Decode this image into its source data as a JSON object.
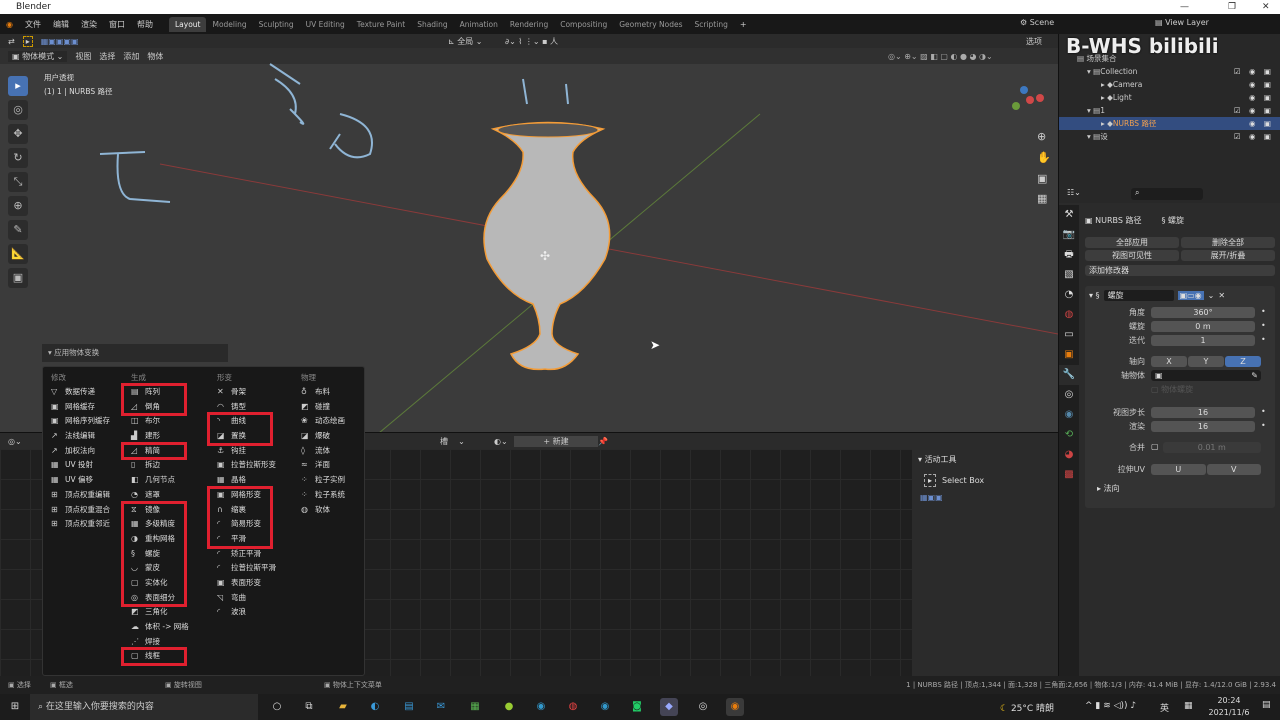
{
  "window": {
    "title": "Blender"
  },
  "menubar": {
    "items": [
      "文件",
      "编辑",
      "渲染",
      "窗口",
      "帮助"
    ],
    "workspaces": [
      "Layout",
      "Modeling",
      "Sculpting",
      "UV Editing",
      "Texture Paint",
      "Shading",
      "Animation",
      "Rendering",
      "Compositing",
      "Geometry Nodes",
      "Scripting"
    ],
    "scene": "Scene",
    "view_layer": "View Layer"
  },
  "viewport": {
    "mode": "物体模式",
    "menus": [
      "视图",
      "选择",
      "添加",
      "物体"
    ],
    "transform_orientation": "全局",
    "options": "选项",
    "view_name": "用户透视",
    "object_info": "(1) 1 | NURBS 路径"
  },
  "watermark": "B-WHS bilibili",
  "outliner": {
    "root": "场景集合",
    "rows": [
      {
        "label": "Collection",
        "level": 1
      },
      {
        "label": "Camera",
        "level": 2
      },
      {
        "label": "Light",
        "level": 2
      },
      {
        "label": "1",
        "level": 1
      },
      {
        "label": "NURBS 路径",
        "level": 2,
        "selected": true
      },
      {
        "label": "设",
        "level": 1
      }
    ]
  },
  "properties": {
    "object": "NURBS 路径",
    "modifier_tab": "螺旋",
    "apply_all": "全部应用",
    "delete_all": "删除全部",
    "viewport_vis": "视图可见性",
    "expand_collapse": "展开/折叠",
    "add_modifier": "添加修改器",
    "modifier": {
      "name": "螺旋",
      "fields": [
        {
          "label": "角度",
          "value": "360°"
        },
        {
          "label": "螺旋",
          "value": "0 m"
        },
        {
          "label": "迭代",
          "value": "1"
        }
      ],
      "axis_label": "轴向",
      "axes": [
        "X",
        "Y",
        "Z"
      ],
      "active_axis": "Z",
      "axis_object_label": "轴物体",
      "object_screw": "物体螺旋",
      "steps": [
        {
          "label": "视图步长",
          "value": "16"
        },
        {
          "label": "渲染",
          "value": "16"
        }
      ],
      "merge_label": "合并",
      "merge_value": "0.01 m",
      "stretch_uv_label": "拉伸UV",
      "uv": [
        "U",
        "V"
      ],
      "normals": "法向"
    }
  },
  "bottom": {
    "header_type": "槽",
    "new_button": "新建",
    "active_tool_title": "活动工具",
    "active_tool": "Select Box"
  },
  "popup": {
    "header": "应用物体变换",
    "columns": [
      {
        "title": "修改",
        "groups": [
          {
            "hl": false,
            "items": [
              [
                "▽",
                "数据传递"
              ],
              [
                "▣",
                "网格缓存"
              ],
              [
                "▣",
                "网格序列缓存"
              ],
              [
                "↗",
                "法线编辑"
              ],
              [
                "↗",
                "加权法向"
              ],
              [
                "▦",
                "UV 投射"
              ],
              [
                "▦",
                "UV 偏移"
              ],
              [
                "⊞",
                "顶点权重编辑"
              ],
              [
                "⊞",
                "顶点权重混合"
              ],
              [
                "⊞",
                "顶点权重邻近"
              ]
            ]
          }
        ]
      },
      {
        "title": "生成",
        "groups": [
          {
            "hl": true,
            "items": [
              [
                "▤",
                "阵列"
              ],
              [
                "◿",
                "倒角"
              ]
            ]
          },
          {
            "hl": false,
            "items": [
              [
                "◫",
                "布尔"
              ],
              [
                "▟",
                "建形"
              ]
            ]
          },
          {
            "hl": true,
            "items": [
              [
                "◿",
                "精简"
              ]
            ]
          },
          {
            "hl": false,
            "items": [
              [
                "▯",
                "拆边"
              ],
              [
                "◧",
                "几何节点"
              ],
              [
                "◔",
                "遮罩"
              ]
            ]
          },
          {
            "hl": true,
            "items": [
              [
                "⧖",
                "镜像"
              ],
              [
                "▦",
                "多级精度"
              ],
              [
                "◑",
                "重构网格"
              ],
              [
                "§",
                "螺旋"
              ],
              [
                "◡",
                "蒙皮"
              ],
              [
                "▢",
                "实体化"
              ],
              [
                "◎",
                "表面细分"
              ]
            ]
          },
          {
            "hl": false,
            "items": [
              [
                "◩",
                "三角化"
              ],
              [
                "☁",
                "体积 -> 网格"
              ],
              [
                "⋰",
                "焊接"
              ]
            ]
          },
          {
            "hl": true,
            "items": [
              [
                "▢",
                "线框"
              ]
            ]
          }
        ]
      },
      {
        "title": "形变",
        "groups": [
          {
            "hl": false,
            "items": [
              [
                "✕",
                "骨架"
              ],
              [
                "◠",
                "铸型"
              ]
            ]
          },
          {
            "hl": true,
            "items": [
              [
                "◝",
                "曲线"
              ],
              [
                "◪",
                "置换"
              ]
            ]
          },
          {
            "hl": false,
            "items": [
              [
                "⚓",
                "钩挂"
              ],
              [
                "▣",
                "拉普拉斯形变"
              ],
              [
                "▦",
                "晶格"
              ]
            ]
          },
          {
            "hl": true,
            "items": [
              [
                "▣",
                "网格形变"
              ],
              [
                "∩",
                "缩裹"
              ],
              [
                "◜",
                "简易形变"
              ],
              [
                "◜",
                "平滑"
              ]
            ]
          },
          {
            "hl": false,
            "items": [
              [
                "◜",
                "矫正平滑"
              ],
              [
                "◜",
                "拉普拉斯平滑"
              ],
              [
                "▣",
                "表面形变"
              ],
              [
                "◹",
                "弯曲"
              ],
              [
                "◜",
                "波浪"
              ]
            ]
          }
        ]
      },
      {
        "title": "物理",
        "groups": [
          {
            "hl": false,
            "items": [
              [
                "♁",
                "布料"
              ],
              [
                "◩",
                "碰撞"
              ],
              [
                "❀",
                "动态绘画"
              ],
              [
                "◪",
                "爆破"
              ],
              [
                "◊",
                "流体"
              ],
              [
                "≈",
                "洋面"
              ],
              [
                "⁘",
                "粒子实例"
              ],
              [
                "⁘",
                "粒子系统"
              ],
              [
                "◍",
                "软体"
              ]
            ]
          }
        ]
      }
    ]
  },
  "status": {
    "items": [
      "选择",
      "框选",
      "旋转视图",
      "物体上下文菜单"
    ],
    "stats": "1 | NURBS 路径 | 顶点:1,344 | 面:1,328 | 三角面:2,656 | 物体:1/3 | 内存: 41.4 MiB | 显存: 1.4/12.0 GiB | 2.93.4"
  },
  "taskbar": {
    "search_placeholder": "在这里输入你要搜索的内容",
    "weather": "25°C 晴朗",
    "ime": "英",
    "time": "20:24",
    "date": "2021/11/6"
  },
  "colors": {
    "accent": "#4772b3",
    "highlight": "#e0202f",
    "selection_outline": "#f39c38"
  }
}
